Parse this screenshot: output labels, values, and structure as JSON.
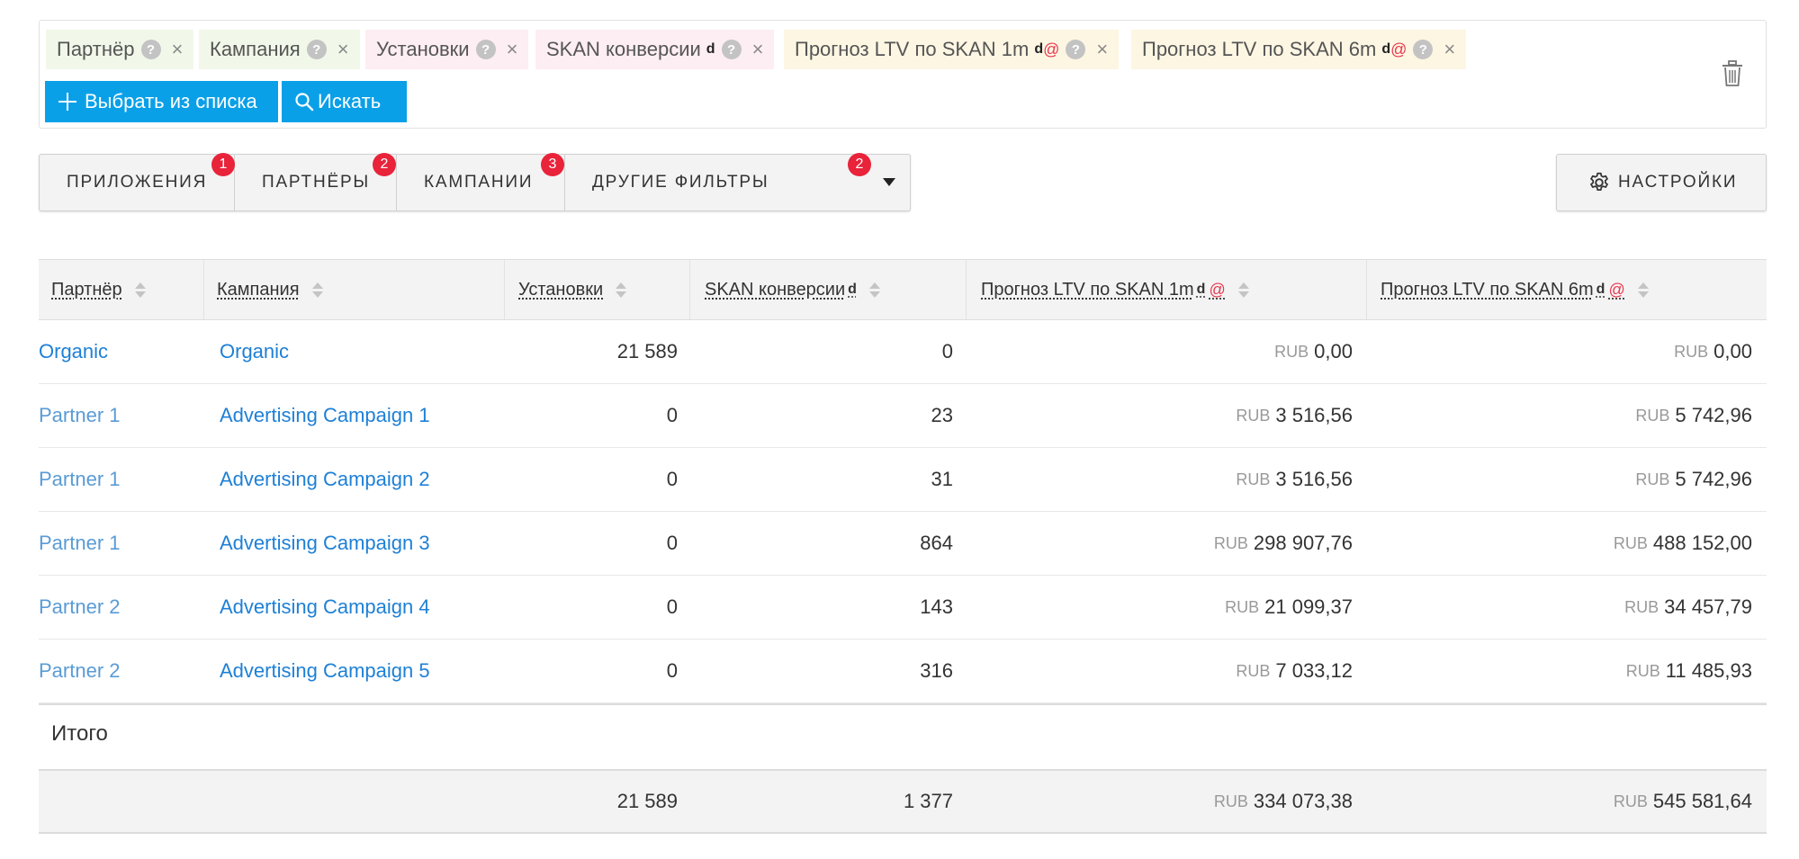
{
  "query": {
    "chips": [
      {
        "label": "Партнёр",
        "color": "#f1f8e9"
      },
      {
        "label": "Кампания",
        "color": "#f1f8e9"
      },
      {
        "label": "Установки",
        "color": "#fdeef3"
      },
      {
        "label": "SKAN конверсии",
        "sup": "d",
        "color": "#fdeef3"
      },
      {
        "label": "Прогноз LTV по SKAN 1m",
        "sup": "d",
        "at": "@",
        "color": "#fdf6e3"
      },
      {
        "label": "Прогноз LTV по SKAN 6m",
        "sup": "d",
        "at": "@",
        "color": "#fdf6e3"
      }
    ],
    "help_glyph": "?",
    "remove_glyph": "×",
    "select_button": "Выбрать из списка",
    "search_button": "Искать"
  },
  "filters": {
    "tabs": [
      {
        "label": "ПРИЛОЖЕНИЯ",
        "badge": "1"
      },
      {
        "label": "ПАРТНЁРЫ",
        "badge": "2"
      },
      {
        "label": "КАМПАНИИ",
        "badge": "3"
      },
      {
        "label": "ДРУГИЕ ФИЛЬТРЫ",
        "badge": "2"
      }
    ],
    "settings_label": "НАСТРОЙКИ"
  },
  "table": {
    "columns": [
      {
        "label": "Партнёр"
      },
      {
        "label": "Кампания"
      },
      {
        "label": "Установки"
      },
      {
        "label": "SKAN конверсии",
        "sup": "d"
      },
      {
        "label": "Прогноз LTV по SKAN 1m",
        "sup": "d",
        "at": "@"
      },
      {
        "label": "Прогноз LTV по SKAN 6m",
        "sup": "d",
        "at": "@"
      }
    ],
    "currency": "RUB",
    "rows": [
      {
        "partner": "Organic",
        "campaign": "Organic",
        "installs": "21 589",
        "skan": "0",
        "ltv1m": "0,00",
        "ltv6m": "0,00"
      },
      {
        "partner": "Partner 1",
        "campaign": "Advertising Campaign 1",
        "installs": "0",
        "skan": "23",
        "ltv1m": "3 516,56",
        "ltv6m": "5 742,96"
      },
      {
        "partner": "Partner 1",
        "campaign": "Advertising Campaign 2",
        "installs": "0",
        "skan": "31",
        "ltv1m": "3 516,56",
        "ltv6m": "5 742,96"
      },
      {
        "partner": "Partner 1",
        "campaign": "Advertising Campaign 3",
        "installs": "0",
        "skan": "864",
        "ltv1m": "298 907,76",
        "ltv6m": "488 152,00"
      },
      {
        "partner": "Partner 2",
        "campaign": "Advertising Campaign 4",
        "installs": "0",
        "skan": "143",
        "ltv1m": "21 099,37",
        "ltv6m": "34 457,79"
      },
      {
        "partner": "Partner 2",
        "campaign": "Advertising Campaign 5",
        "installs": "0",
        "skan": "316",
        "ltv1m": "7 033,12",
        "ltv6m": "11 485,93"
      }
    ],
    "total_label": "Итого",
    "totals": {
      "installs": "21 589",
      "skan": "1 377",
      "ltv1m": "334 073,38",
      "ltv6m": "545 581,64"
    }
  },
  "colors": {
    "accent": "#0aa0e8",
    "badge": "#e8233a",
    "link": "#1e80d6"
  }
}
